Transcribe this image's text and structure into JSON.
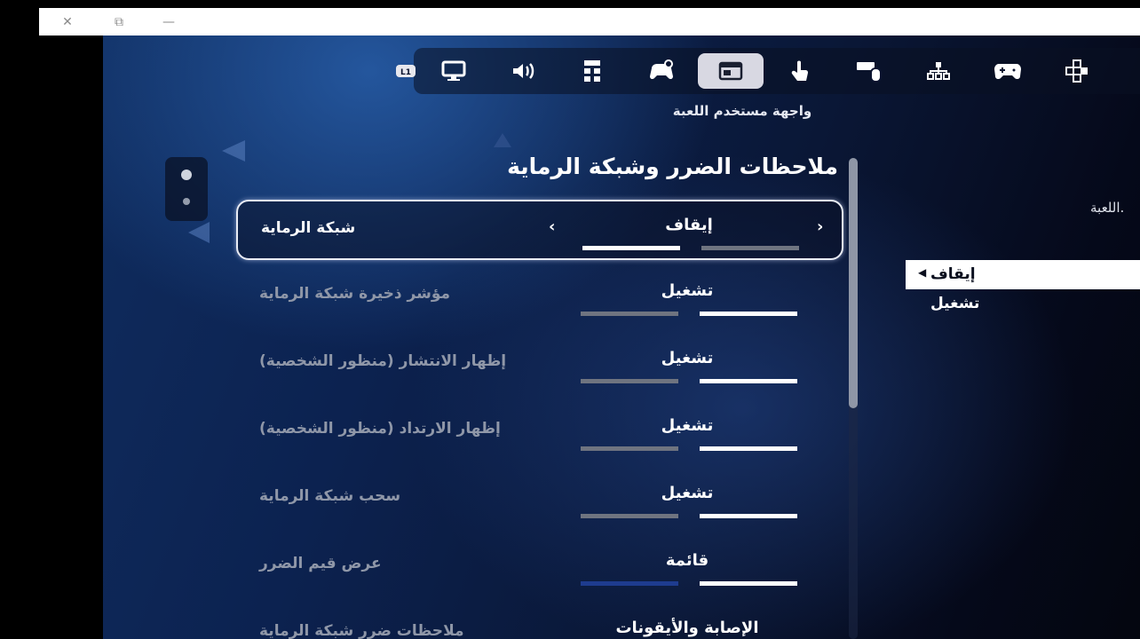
{
  "window": {
    "close_glyph": "✕",
    "restore_glyph": "⧉",
    "minimize_glyph": "—"
  },
  "tabs": [
    {
      "icon": "l1-bumper-icon",
      "glyph": "L1"
    },
    {
      "icon": "monitor-icon"
    },
    {
      "icon": "speaker-icon"
    },
    {
      "icon": "accessibility-grid-icon"
    },
    {
      "icon": "controller-gear-icon"
    },
    {
      "icon": "game-ui-window-icon",
      "active": true
    },
    {
      "icon": "touch-icon"
    },
    {
      "icon": "keyboard-mouse-icon"
    },
    {
      "icon": "network-icon"
    },
    {
      "icon": "gamepad-icon"
    },
    {
      "icon": "dpad-icon"
    }
  ],
  "tab_caption": "واجهة مستخدم اللعبة",
  "panel": {
    "title": "ملاحظات الضرر وشبكة الرماية",
    "rows": [
      {
        "label": "شبكة الرماية",
        "value": "إيقاف",
        "selected": true
      },
      {
        "label": "مؤشر ذخيرة شبكة الرماية",
        "value": "تشغيل"
      },
      {
        "label": "إظهار الانتشار (منظور الشخصية)",
        "value": "تشغيل"
      },
      {
        "label": "إظهار الارتداد (منظور الشخصية)",
        "value": "تشغيل"
      },
      {
        "label": "سحب شبكة الرماية",
        "value": "تشغيل"
      },
      {
        "label": "عرض قيم الضرر",
        "value": "قائمة"
      },
      {
        "label": "ملاحظات ضرر شبكة الرماية",
        "value": "الإصابة والأيقونات"
      }
    ]
  },
  "side_panel": {
    "hint": "اللعبة.",
    "options": [
      {
        "label": "إيقاف",
        "selected": true
      },
      {
        "label": "تشغيل"
      }
    ]
  },
  "colors": {
    "accent_active_tab": "#d8d8e2",
    "bar_lit": "#ffffff",
    "bar_dim": "#6f7480",
    "bar_blue": "#1e3c8f"
  }
}
